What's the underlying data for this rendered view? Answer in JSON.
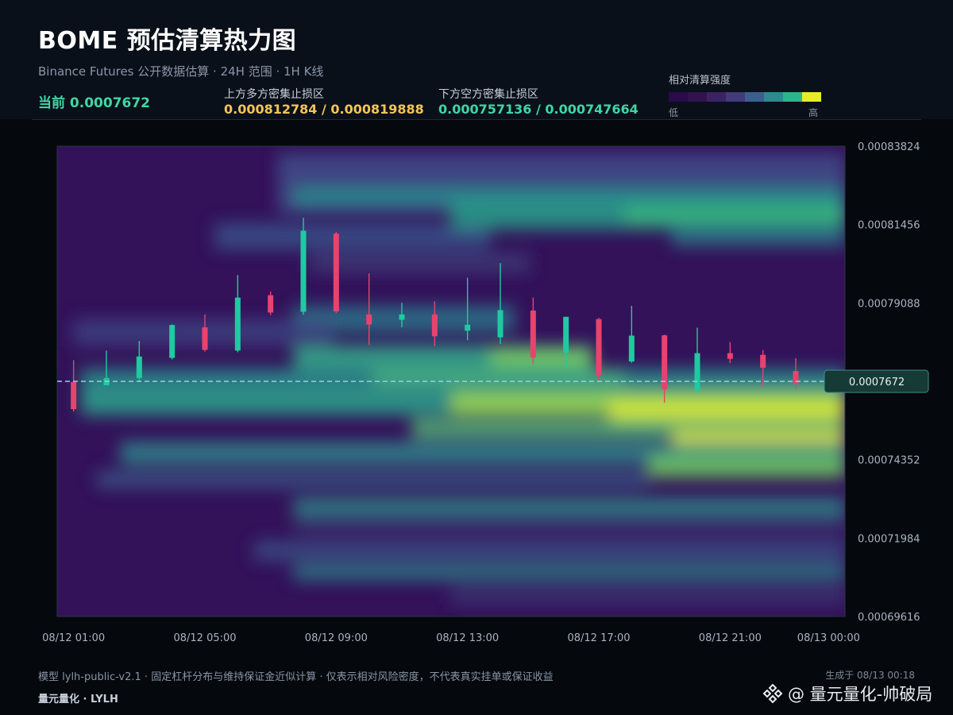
{
  "header": {
    "title": "BOME 预估清算热力图",
    "subtitle": "Binance Futures 公开数据估算 · 24H 范围 · 1H K线",
    "current_label": "当前 0.0007672",
    "upper_label": "上方多方密集止损区",
    "upper_value": "0.000812784 / 0.000819888",
    "lower_label": "下方空方密集止损区",
    "lower_value": "0.000757136 / 0.000747664"
  },
  "legend": {
    "title": "相对清算强度",
    "low": "低",
    "high": "高",
    "colors": [
      "#2a0a4a",
      "#32124f",
      "#3b2265",
      "#413b7c",
      "#3a5f8e",
      "#2d8a8e",
      "#2fb38c",
      "#e7ec2a"
    ]
  },
  "colors": {
    "up_candle": "#1ecba0",
    "down_candle": "#e8436d",
    "current_line": "#8fd6e0",
    "upper_zone": "#f2c45a",
    "lower_zone": "#3fd6a6"
  },
  "chart_data": {
    "type": "heatmap",
    "overlay": "candlestick",
    "y_ticks": [
      "0.00083824",
      "0.00081456",
      "0.00079088",
      "0.00076720",
      "0.00074352",
      "0.00071984",
      "0.00069616"
    ],
    "y_tick_labels": [
      "0.00083824",
      "0.00081456",
      "0.00079088",
      "",
      "0.00074352",
      "0.00071984",
      "0.00069616"
    ],
    "ylim": [
      0.00069616,
      0.00083824
    ],
    "x_tick_labels": [
      "08/12 01:00",
      "08/12 05:00",
      "08/12 09:00",
      "08/12 13:00",
      "08/12 17:00",
      "08/12 21:00",
      "08/13 00:00"
    ],
    "x_tick_hours": [
      0,
      4,
      8,
      12,
      16,
      20,
      23
    ],
    "current_price": 0.0007672,
    "current_price_label": "0.0007672",
    "candles": [
      {
        "t": "08/12 01:00",
        "o": 0.000767,
        "h": 0.0007736,
        "l": 0.0007581,
        "c": 0.0007588
      },
      {
        "t": "08/12 02:00",
        "o": 0.000766,
        "h": 0.0007765,
        "l": 0.000766,
        "c": 0.0007682
      },
      {
        "t": "08/12 03:00",
        "o": 0.0007682,
        "h": 0.0007794,
        "l": 0.000767,
        "c": 0.0007747
      },
      {
        "t": "08/12 04:00",
        "o": 0.0007743,
        "h": 0.0007844,
        "l": 0.0007738,
        "c": 0.0007842
      },
      {
        "t": "08/12 05:00",
        "o": 0.0007835,
        "h": 0.0007874,
        "l": 0.0007762,
        "c": 0.0007767
      },
      {
        "t": "08/12 06:00",
        "o": 0.0007765,
        "h": 0.0007993,
        "l": 0.000776,
        "c": 0.0007925
      },
      {
        "t": "08/12 07:00",
        "o": 0.0007932,
        "h": 0.0007943,
        "l": 0.0007872,
        "c": 0.000788
      },
      {
        "t": "08/12 08:00",
        "o": 0.0007882,
        "h": 0.0008166,
        "l": 0.0007873,
        "c": 0.0008127
      },
      {
        "t": "08/12 09:00",
        "o": 0.0008118,
        "h": 0.0008123,
        "l": 0.0007878,
        "c": 0.0007883
      },
      {
        "t": "08/12 10:00",
        "o": 0.0007874,
        "h": 0.0007998,
        "l": 0.0007782,
        "c": 0.0007844
      },
      {
        "t": "08/12 11:00",
        "o": 0.0007858,
        "h": 0.0007909,
        "l": 0.0007835,
        "c": 0.0007874
      },
      {
        "t": "08/12 12:00",
        "o": 0.0007874,
        "h": 0.0007914,
        "l": 0.0007778,
        "c": 0.0007808
      },
      {
        "t": "08/12 13:00",
        "o": 0.0007825,
        "h": 0.0007985,
        "l": 0.0007796,
        "c": 0.0007843
      },
      {
        "t": "08/12 14:00",
        "o": 0.0007805,
        "h": 0.0008029,
        "l": 0.0007785,
        "c": 0.0007887
      },
      {
        "t": "08/12 15:00",
        "o": 0.0007886,
        "h": 0.0007925,
        "l": 0.0007726,
        "c": 0.0007744
      },
      {
        "t": "08/12 16:00",
        "o": 0.0007758,
        "h": 0.0007861,
        "l": 0.0007712,
        "c": 0.0007867
      },
      {
        "t": "08/12 17:00",
        "o": 0.000786,
        "h": 0.0007864,
        "l": 0.0007675,
        "c": 0.0007691
      },
      {
        "t": "08/12 18:00",
        "o": 0.0007732,
        "h": 0.00079,
        "l": 0.0007728,
        "c": 0.000781
      },
      {
        "t": "08/12 19:00",
        "o": 0.0007811,
        "h": 0.0007813,
        "l": 0.0007608,
        "c": 0.0007648
      },
      {
        "t": "08/12 20:00",
        "o": 0.0007642,
        "h": 0.0007834,
        "l": 0.0007638,
        "c": 0.0007757
      },
      {
        "t": "08/12 21:00",
        "o": 0.0007757,
        "h": 0.0007791,
        "l": 0.0007727,
        "c": 0.000774
      },
      {
        "t": "08/12 22:00",
        "o": 0.0007752,
        "h": 0.0007767,
        "l": 0.0007657,
        "c": 0.0007713
      },
      {
        "t": "08/12 23:00",
        "o": 0.0007703,
        "h": 0.0007742,
        "l": 0.0007648,
        "c": 0.0007666
      }
    ]
  },
  "footer": {
    "note": "模型 lylh-public-v2.1 · 固定杠杆分布与维持保证金近似计算 · 仅表示相对风险密度，不代表真实挂单或保证收益",
    "generated": "生成于 08/13 00:18",
    "brand": "量元量化 · LYLH",
    "watermark": "@ 量元量化-帅破局"
  }
}
